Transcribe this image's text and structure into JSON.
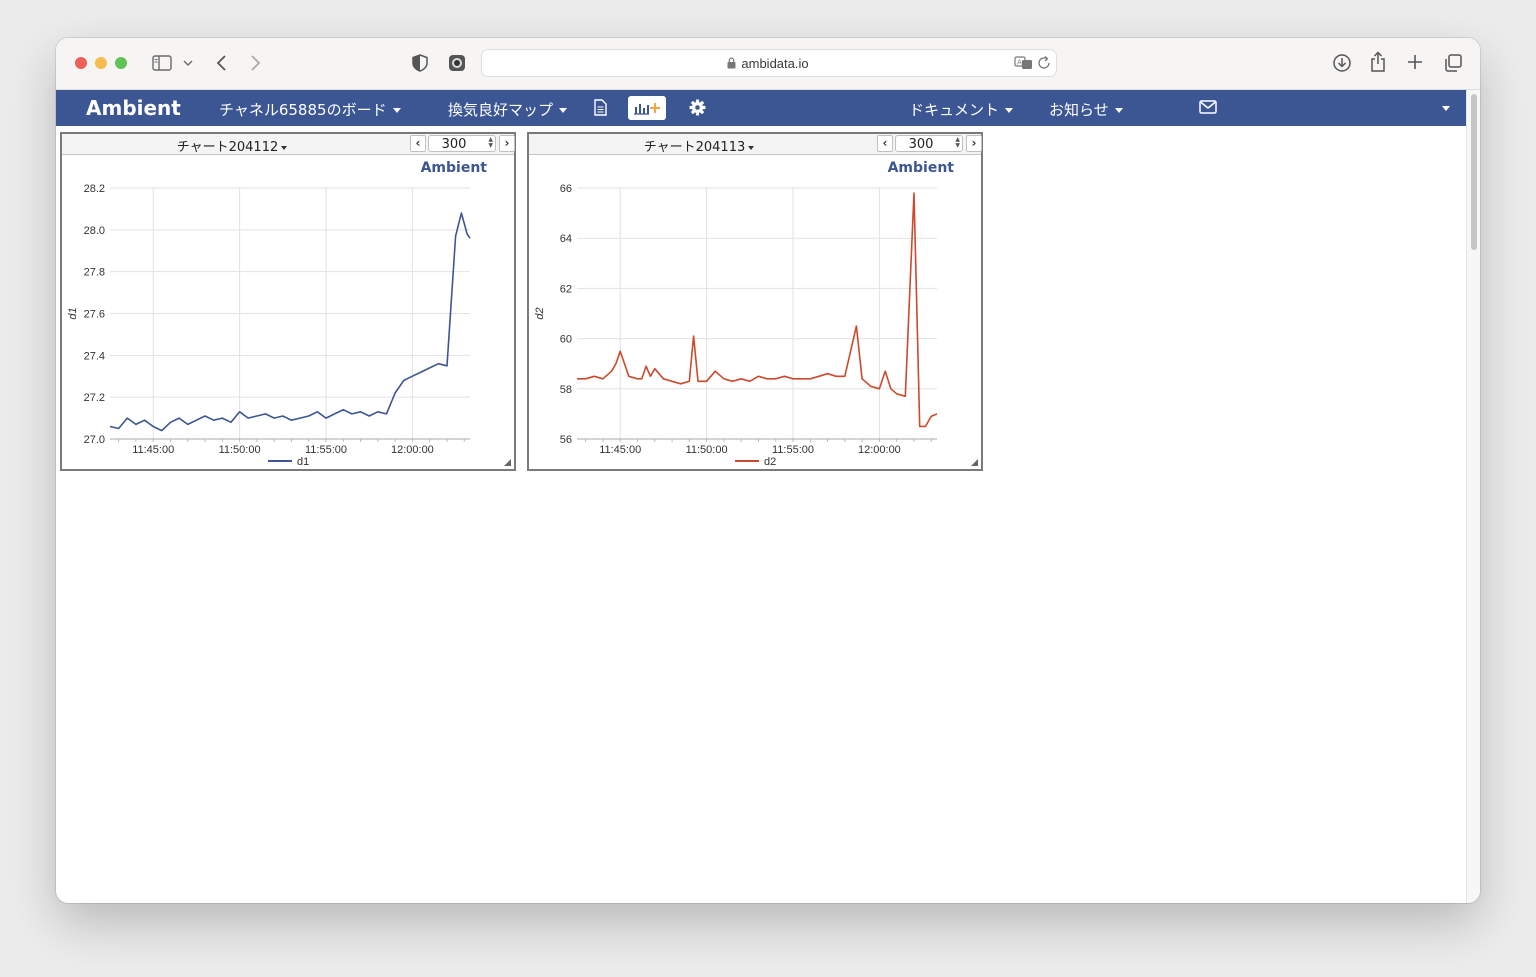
{
  "browser": {
    "url": "ambidata.io"
  },
  "navbar": {
    "brand": "Ambient",
    "board_menu": "チャネル65885のボード",
    "map_menu": "換気良好マップ",
    "docs_menu": "ドキュメント",
    "news_menu": "お知らせ"
  },
  "charts": [
    {
      "title": "チャート204112",
      "range": "300",
      "watermark": "Ambient",
      "ylabel": "d1",
      "legend": "d1",
      "y_ticks": [
        "27.0",
        "27.2",
        "27.4",
        "27.6",
        "27.8",
        "28.0",
        "28.2"
      ],
      "x_ticks": [
        "11:45:00",
        "11:50:00",
        "11:55:00",
        "12:00:00"
      ]
    },
    {
      "title": "チャート204113",
      "range": "300",
      "watermark": "Ambient",
      "ylabel": "d2",
      "legend": "d2",
      "y_ticks": [
        "56",
        "58",
        "60",
        "62",
        "64",
        "66"
      ],
      "x_ticks": [
        "11:45:00",
        "11:50:00",
        "11:55:00",
        "12:00:00"
      ]
    }
  ],
  "chart_data": [
    {
      "type": "line",
      "color": "#3c5694",
      "ylim": [
        27.0,
        28.2
      ],
      "xlim": [
        "11:42:30",
        "12:03:20"
      ],
      "series": [
        {
          "name": "d1",
          "x": [
            "11:42:30",
            "11:43:00",
            "11:43:30",
            "11:44:00",
            "11:44:30",
            "11:45:00",
            "11:45:30",
            "11:46:00",
            "11:46:30",
            "11:47:00",
            "11:47:30",
            "11:48:00",
            "11:48:30",
            "11:49:00",
            "11:49:30",
            "11:50:00",
            "11:50:30",
            "11:51:00",
            "11:51:30",
            "11:52:00",
            "11:52:30",
            "11:53:00",
            "11:53:30",
            "11:54:00",
            "11:54:30",
            "11:55:00",
            "11:55:30",
            "11:56:00",
            "11:56:30",
            "11:57:00",
            "11:57:30",
            "11:58:00",
            "11:58:30",
            "11:59:00",
            "11:59:30",
            "12:00:00",
            "12:00:30",
            "12:01:00",
            "12:01:30",
            "12:02:00",
            "12:02:30",
            "12:02:50",
            "12:03:10",
            "12:03:20"
          ],
          "y": [
            27.06,
            27.05,
            27.1,
            27.07,
            27.09,
            27.06,
            27.04,
            27.08,
            27.1,
            27.07,
            27.09,
            27.11,
            27.09,
            27.1,
            27.08,
            27.13,
            27.1,
            27.11,
            27.12,
            27.1,
            27.11,
            27.09,
            27.1,
            27.11,
            27.13,
            27.1,
            27.12,
            27.14,
            27.12,
            27.13,
            27.11,
            27.13,
            27.12,
            27.22,
            27.28,
            27.3,
            27.32,
            27.34,
            27.36,
            27.35,
            27.97,
            28.08,
            27.98,
            27.96
          ]
        }
      ]
    },
    {
      "type": "line",
      "color": "#cc4a2c",
      "ylim": [
        56,
        66
      ],
      "xlim": [
        "11:42:30",
        "12:03:20"
      ],
      "series": [
        {
          "name": "d2",
          "x": [
            "11:42:30",
            "11:43:00",
            "11:43:30",
            "11:44:00",
            "11:44:30",
            "11:44:45",
            "11:45:00",
            "11:45:30",
            "11:46:00",
            "11:46:15",
            "11:46:30",
            "11:46:45",
            "11:47:00",
            "11:47:30",
            "11:48:00",
            "11:48:30",
            "11:49:00",
            "11:49:15",
            "11:49:30",
            "11:50:00",
            "11:50:30",
            "11:51:00",
            "11:51:30",
            "11:52:00",
            "11:52:30",
            "11:53:00",
            "11:53:30",
            "11:54:00",
            "11:54:30",
            "11:55:00",
            "11:55:30",
            "11:56:00",
            "11:56:30",
            "11:57:00",
            "11:57:30",
            "11:58:00",
            "11:58:40",
            "11:59:00",
            "11:59:30",
            "12:00:00",
            "12:00:20",
            "12:00:40",
            "12:01:00",
            "12:01:30",
            "12:02:00",
            "12:02:20",
            "12:02:40",
            "12:03:00",
            "12:03:20"
          ],
          "y": [
            58.4,
            58.4,
            58.5,
            58.4,
            58.7,
            59.0,
            59.5,
            58.5,
            58.4,
            58.4,
            58.9,
            58.5,
            58.8,
            58.4,
            58.3,
            58.2,
            58.3,
            60.1,
            58.3,
            58.3,
            58.7,
            58.4,
            58.3,
            58.4,
            58.3,
            58.5,
            58.4,
            58.4,
            58.5,
            58.4,
            58.4,
            58.4,
            58.5,
            58.6,
            58.5,
            58.5,
            60.5,
            58.4,
            58.1,
            58.0,
            58.7,
            58.0,
            57.8,
            57.7,
            65.8,
            56.5,
            56.5,
            56.9,
            57.0
          ]
        }
      ]
    }
  ]
}
